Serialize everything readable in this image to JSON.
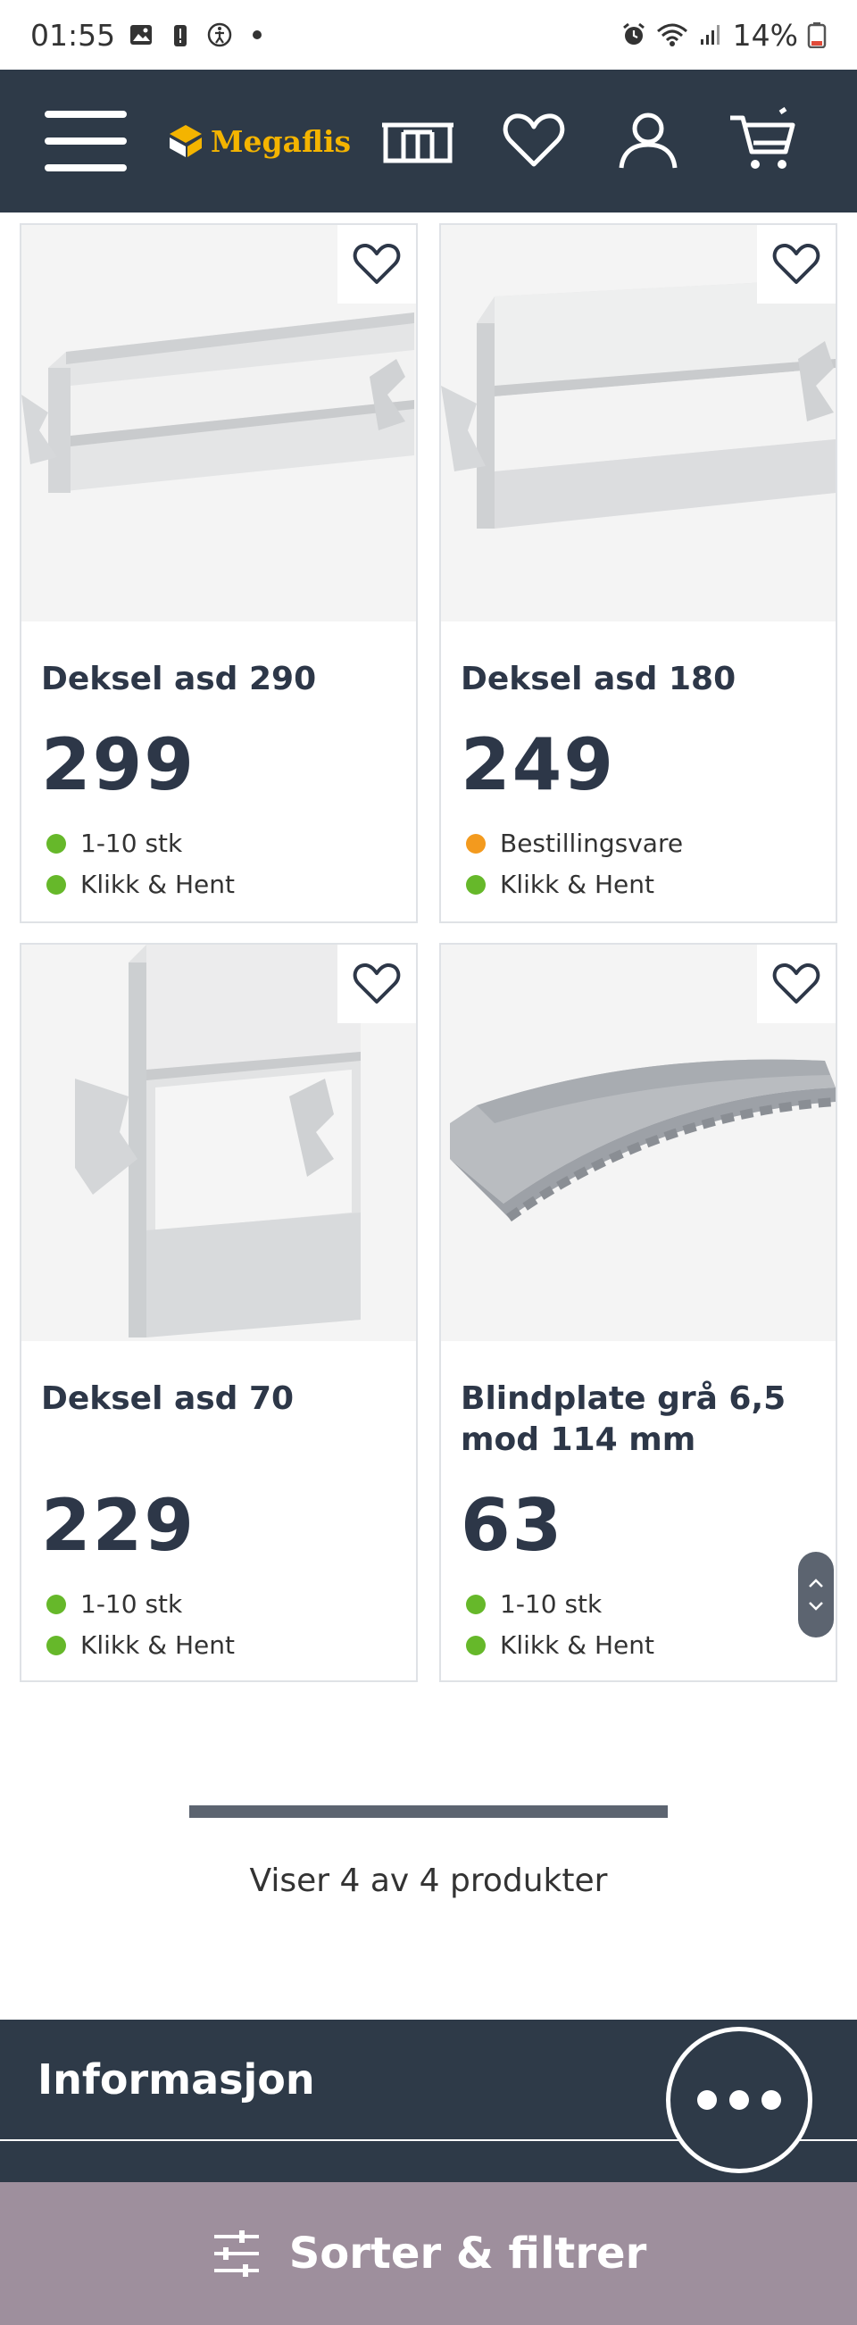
{
  "status_bar": {
    "time": "01:55",
    "battery": "14%"
  },
  "header": {
    "logo_text": "Megaflis"
  },
  "products": [
    {
      "name": "Deksel asd 290",
      "price": "299",
      "stock": "1-10 stk",
      "stock_color": "#66b82a",
      "pickup": "Klikk & Hent",
      "pickup_color": "#66b82a"
    },
    {
      "name": "Deksel asd 180",
      "price": "249",
      "stock": "Bestillingsvare",
      "stock_color": "#f39a1e",
      "pickup": "Klikk & Hent",
      "pickup_color": "#66b82a"
    },
    {
      "name": "Deksel asd 70",
      "price": "229",
      "stock": "1-10 stk",
      "stock_color": "#66b82a",
      "pickup": "Klikk & Hent",
      "pickup_color": "#66b82a"
    },
    {
      "name": "Blindplate grå 6,5 mod 114 mm",
      "price": "63",
      "stock": "1-10 stk",
      "stock_color": "#66b82a",
      "pickup": "Klikk & Hent",
      "pickup_color": "#66b82a"
    }
  ],
  "listing": {
    "progress_fraction": 1.0,
    "count_text": "Viser 4 av 4 produkter"
  },
  "footer": {
    "info_title": "Informasjon",
    "filter_label": "Sorter & filtrer"
  },
  "colors": {
    "header_bg": "#2e3a48",
    "logo_yellow": "#f4b400",
    "filter_bg": "#9e8f9d"
  }
}
